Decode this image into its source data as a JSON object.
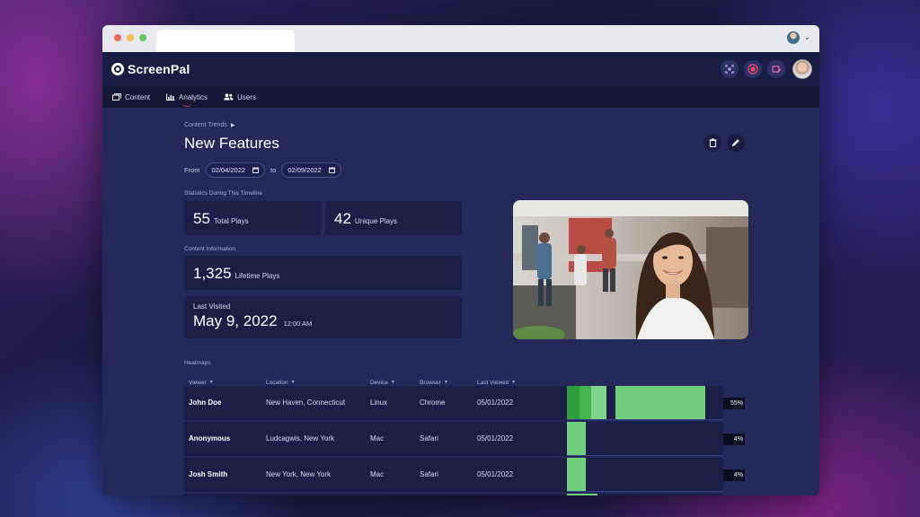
{
  "app": {
    "brand": "ScreenPal",
    "nav": [
      {
        "label": "Content",
        "icon": "content-icon"
      },
      {
        "label": "Analytics",
        "icon": "chart-icon"
      },
      {
        "label": "Users",
        "icon": "users-icon"
      }
    ],
    "top_icons": [
      "screenshot-icon",
      "record-icon",
      "edit-video-icon"
    ],
    "colors": {
      "accent": "#e0334f",
      "heat_light": "#6fcf7f",
      "heat_dark": "#2e9b3d",
      "heat_mid": "#44b350"
    }
  },
  "page": {
    "breadcrumb": "Content Trends",
    "title": "New Features",
    "from_label": "From",
    "to_label": "to",
    "from_date": "02/04/2022",
    "to_date": "02/09/2022",
    "stats_label": "Statistics During This Timeline",
    "total_plays_value": "55",
    "total_plays_label": "Total Plays",
    "unique_plays_value": "42",
    "unique_plays_label": "Unique Plays",
    "content_info_label": "Content Information",
    "lifetime_plays_value": "1,325",
    "lifetime_plays_label": "Lifetime Plays",
    "last_visited_label": "Last Visited",
    "last_visited_date": "May 9, 2022",
    "last_visited_time": "12:00 AM",
    "heatmaps_label": "Heatmaps"
  },
  "table": {
    "headers": [
      "Viewer",
      "Location",
      "Device",
      "Browser",
      "Last Viewed"
    ],
    "rows": [
      {
        "viewer": "John Doe",
        "location": "New Haven, Connecticut",
        "device": "Linux",
        "browser": "Chrome",
        "last_viewed": "05/01/2022",
        "percent": "55%"
      },
      {
        "viewer": "Anonymous",
        "location": "Ludcagwis, New York",
        "device": "Mac",
        "browser": "Safari",
        "last_viewed": "05/01/2022",
        "percent": "4%"
      },
      {
        "viewer": "Josh Smith",
        "location": "New York, New York",
        "device": "Mac",
        "browser": "Safari",
        "last_viewed": "05/01/2022",
        "percent": "4%"
      }
    ]
  }
}
